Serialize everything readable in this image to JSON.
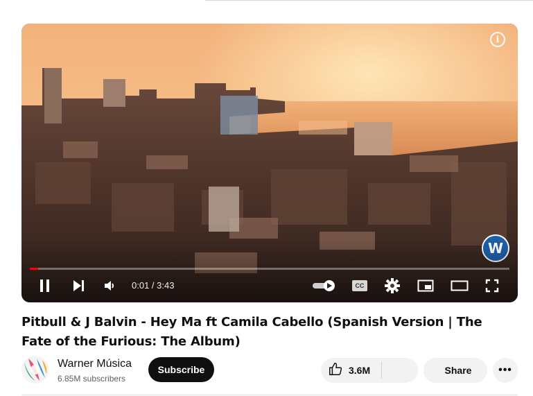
{
  "player": {
    "info_icon": "info-icon",
    "channel_watermark_icon": "warner-logo-icon",
    "watermark_letter": "W",
    "progress": 0.005,
    "accent_color": "#ff0000",
    "time_display": "0:01 / 3:43",
    "controls": [
      "pause-icon",
      "next-icon",
      "volume-icon",
      "autoplay-toggle-icon",
      "captions-icon",
      "settings-icon",
      "miniplayer-icon",
      "theater-icon",
      "fullscreen-icon"
    ],
    "cc_label": "CC"
  },
  "video": {
    "title": "Pitbull & J Balvin - Hey Ma ft Camila Cabello (Spanish Version | The Fate of the Furious: The Album)"
  },
  "channel": {
    "name": "Warner Música",
    "subscribers": "6.85M subscribers",
    "subscribe_label": "Subscribe"
  },
  "actions": {
    "like_count": "3.6M",
    "share_label": "Share",
    "more_label": "•••"
  }
}
